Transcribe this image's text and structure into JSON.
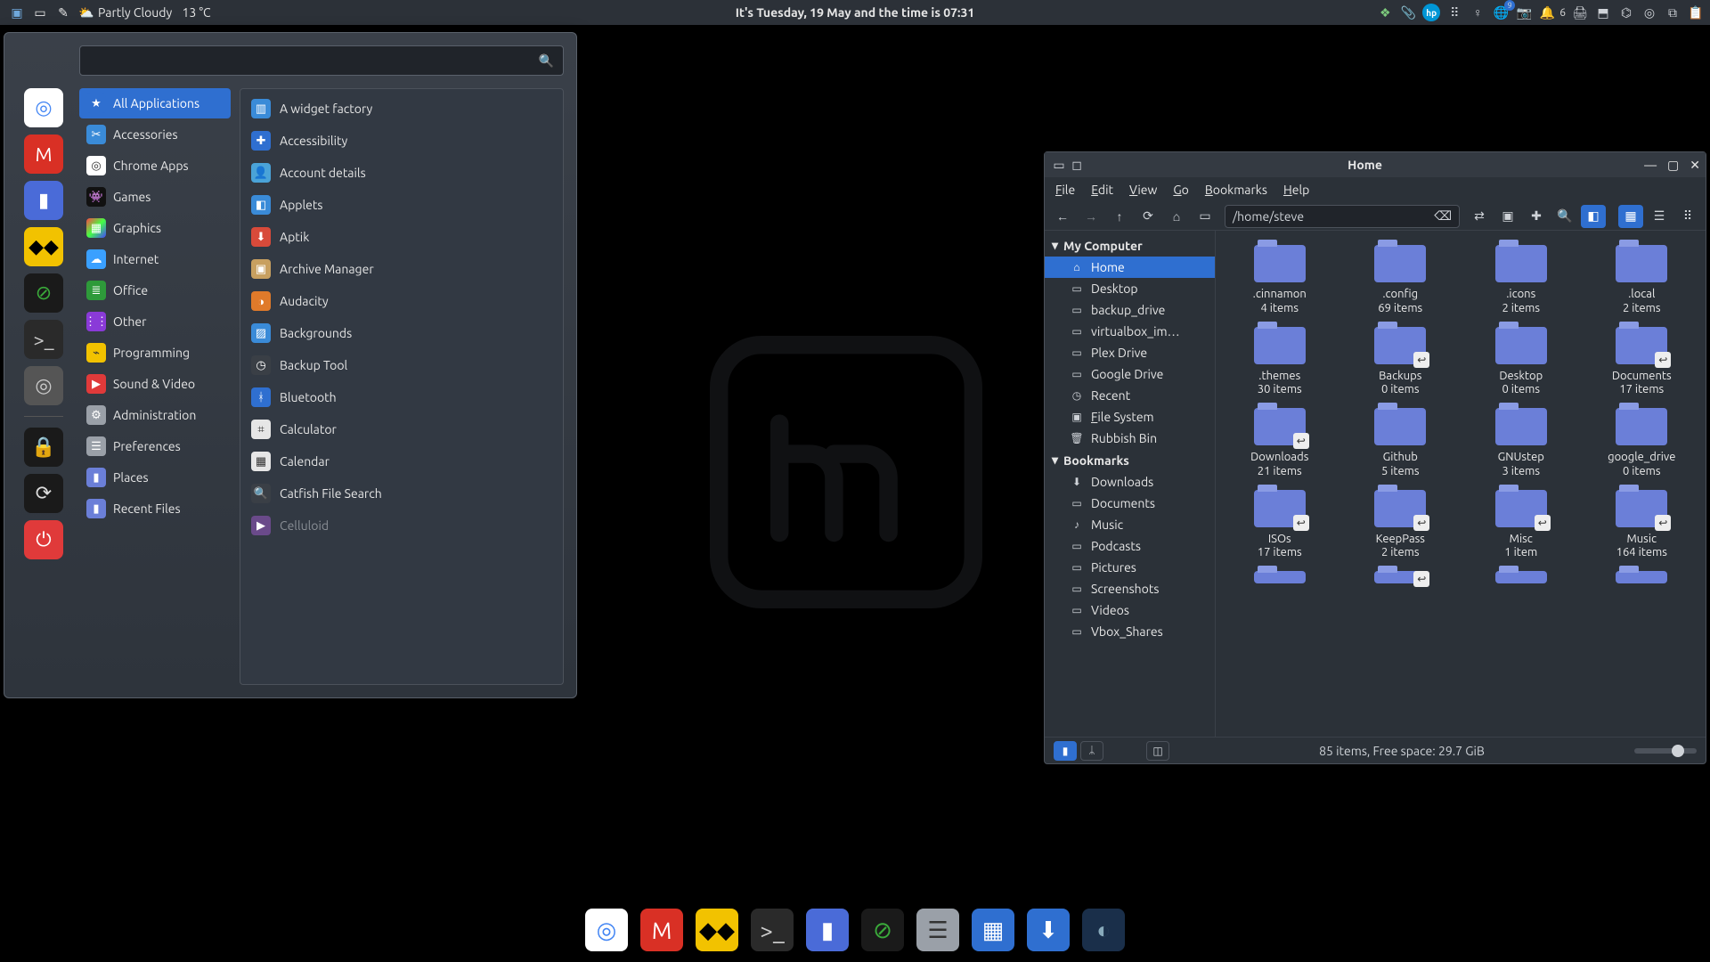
{
  "panel": {
    "weather": {
      "text": "Partly Cloudy",
      "temp": "13 °C"
    },
    "clock": "It's Tuesday, 19 May and the time is 07:31",
    "notif_count": "6",
    "badge_small": "9"
  },
  "menu": {
    "search_placeholder": "",
    "categories": [
      {
        "label": "All Applications",
        "color": "#2f6fd0",
        "active": true,
        "ico": "★"
      },
      {
        "label": "Accessories",
        "color": "#3a8bd8",
        "ico": "✂"
      },
      {
        "label": "Chrome Apps",
        "color": "#ffffff",
        "ico": "◎"
      },
      {
        "label": "Games",
        "color": "#111",
        "ico": "👾"
      },
      {
        "label": "Graphics",
        "color": "linear",
        "ico": "▦"
      },
      {
        "label": "Internet",
        "color": "#3aa0ff",
        "ico": "☁"
      },
      {
        "label": "Office",
        "color": "#2e9a3a",
        "ico": "≣"
      },
      {
        "label": "Other",
        "color": "#8a3ad8",
        "ico": "⋮⋮"
      },
      {
        "label": "Programming",
        "color": "#f2c200",
        "ico": "⌁"
      },
      {
        "label": "Sound & Video",
        "color": "#e03a3a",
        "ico": "▶"
      },
      {
        "label": "Administration",
        "color": "#9aa0a8",
        "ico": "⚙"
      },
      {
        "label": "Preferences",
        "color": "#9aa0a8",
        "ico": "☰"
      },
      {
        "label": "Places",
        "color": "#6b7fd8",
        "ico": "▮"
      },
      {
        "label": "Recent Files",
        "color": "#6b7fd8",
        "ico": "▮"
      }
    ],
    "apps": [
      {
        "label": "A widget factory",
        "ico": "▥",
        "bg": "#3a8bd8"
      },
      {
        "label": "Accessibility",
        "ico": "✚",
        "bg": "#2f6fd0"
      },
      {
        "label": "Account details",
        "ico": "👤",
        "bg": "#4aa3d8"
      },
      {
        "label": "Applets",
        "ico": "◧",
        "bg": "#3a8bd8"
      },
      {
        "label": "Aptik",
        "ico": "⬇",
        "bg": "#d84a3a"
      },
      {
        "label": "Archive Manager",
        "ico": "▣",
        "bg": "#c8a060"
      },
      {
        "label": "Audacity",
        "ico": "◑",
        "bg": "#e07a2a"
      },
      {
        "label": "Backgrounds",
        "ico": "▨",
        "bg": "#3a8bd8"
      },
      {
        "label": "Backup Tool",
        "ico": "◷",
        "bg": "#3a3f46"
      },
      {
        "label": "Bluetooth",
        "ico": "ᚼ",
        "bg": "#2f6fd0"
      },
      {
        "label": "Calculator",
        "ico": "⌗",
        "bg": "#e6e6e6"
      },
      {
        "label": "Calendar",
        "ico": "▦",
        "bg": "#e6e6e6"
      },
      {
        "label": "Catfish File Search",
        "ico": "🔍",
        "bg": "#3a3f46"
      },
      {
        "label": "Celluloid",
        "ico": "▶",
        "bg": "#6a4a8a",
        "dim": true
      }
    ],
    "favorites": [
      {
        "name": "chrome",
        "bg": "#fff",
        "glyph": "◎",
        "fg": "#4285f4"
      },
      {
        "name": "gmail",
        "bg": "#d93025",
        "glyph": "M",
        "fg": "#fff"
      },
      {
        "name": "files",
        "bg": "#4a6bd8",
        "glyph": "▮",
        "fg": "#fff"
      },
      {
        "name": "plex",
        "bg": "#f2c200",
        "glyph": "◆◆",
        "fg": "#000"
      },
      {
        "name": "keepass",
        "bg": "#1a1a1a",
        "glyph": "⊘",
        "fg": "#3aaa3a"
      },
      {
        "name": "terminal",
        "bg": "#2a2a2a",
        "glyph": ">_",
        "fg": "#ccc"
      },
      {
        "name": "steam",
        "bg": "#555",
        "glyph": "◎",
        "fg": "#ccc"
      }
    ],
    "session": [
      {
        "name": "lock",
        "bg": "#1a1a1a",
        "glyph": "🔒",
        "fg": "#fff"
      },
      {
        "name": "logout",
        "bg": "#1a1a1a",
        "glyph": "⟳",
        "fg": "#ddd"
      },
      {
        "name": "shutdown",
        "bg": "#e03a3a",
        "glyph": "⏻",
        "fg": "#fff"
      }
    ]
  },
  "dock": [
    {
      "name": "chrome",
      "bg": "#fff",
      "glyph": "◎",
      "fg": "#4285f4"
    },
    {
      "name": "gmail",
      "bg": "#d93025",
      "glyph": "M",
      "fg": "#fff"
    },
    {
      "name": "plex",
      "bg": "#f2c200",
      "glyph": "◆◆",
      "fg": "#000"
    },
    {
      "name": "terminal",
      "bg": "#2a2a2a",
      "glyph": ">_",
      "fg": "#ccc"
    },
    {
      "name": "files",
      "bg": "#4a6bd8",
      "glyph": "▮",
      "fg": "#fff"
    },
    {
      "name": "keepass",
      "bg": "#1a1a1a",
      "glyph": "⊘",
      "fg": "#3aaa3a"
    },
    {
      "name": "settings",
      "bg": "#9aa0a8",
      "glyph": "☰",
      "fg": "#333"
    },
    {
      "name": "virtualbox",
      "bg": "#2f6fd0",
      "glyph": "▦",
      "fg": "#fff"
    },
    {
      "name": "updater",
      "bg": "#2f6fd0",
      "glyph": "⬇",
      "fg": "#fff"
    },
    {
      "name": "dark-app",
      "bg": "#1a2f4a",
      "glyph": "◐",
      "fg": "#8ab"
    }
  ],
  "fm": {
    "title": "Home",
    "menus": [
      "File",
      "Edit",
      "View",
      "Go",
      "Bookmarks",
      "Help"
    ],
    "path": "/home/steve",
    "side": {
      "mycomputer": "My Computer",
      "items1": [
        {
          "label": "Home",
          "ico": "⌂",
          "sel": true
        },
        {
          "label": "Desktop",
          "ico": "▭"
        },
        {
          "label": "backup_drive",
          "ico": "▭"
        },
        {
          "label": "virtualbox_im…",
          "ico": "▭"
        },
        {
          "label": "Plex Drive",
          "ico": "▭"
        },
        {
          "label": "Google Drive",
          "ico": "▭"
        },
        {
          "label": "Recent",
          "ico": "◷"
        },
        {
          "label": "File System",
          "ico": "▣",
          "u": "F"
        },
        {
          "label": "Rubbish Bin",
          "ico": "🗑"
        }
      ],
      "bookmarks": "Bookmarks",
      "items2": [
        {
          "label": "Downloads",
          "ico": "⬇"
        },
        {
          "label": "Documents",
          "ico": "▭"
        },
        {
          "label": "Music",
          "ico": "♪"
        },
        {
          "label": "Podcasts",
          "ico": "▭"
        },
        {
          "label": "Pictures",
          "ico": "▭"
        },
        {
          "label": "Screenshots",
          "ico": "▭"
        },
        {
          "label": "Videos",
          "ico": "▭"
        },
        {
          "label": "Vbox_Shares",
          "ico": "▭"
        }
      ]
    },
    "grid": [
      {
        "name": ".cinnamon",
        "count": "4 items"
      },
      {
        "name": ".config",
        "count": "69 items"
      },
      {
        "name": ".icons",
        "count": "2 items"
      },
      {
        "name": ".local",
        "count": "2 items"
      },
      {
        "name": ".themes",
        "count": "30 items"
      },
      {
        "name": "Backups",
        "count": "0 items",
        "link": true
      },
      {
        "name": "Desktop",
        "count": "0 items"
      },
      {
        "name": "Documents",
        "count": "17 items",
        "link": true
      },
      {
        "name": "Downloads",
        "count": "21 items",
        "link": true
      },
      {
        "name": "Github",
        "count": "5 items"
      },
      {
        "name": "GNUstep",
        "count": "3 items"
      },
      {
        "name": "google_drive",
        "count": "0 items"
      },
      {
        "name": "ISOs",
        "count": "17 items",
        "link": true
      },
      {
        "name": "KeepPass",
        "count": "2 items",
        "link": true
      },
      {
        "name": "Misc",
        "count": "1 item",
        "link": true
      },
      {
        "name": "Music",
        "count": "164 items",
        "link": true
      },
      {
        "name": "",
        "count": "",
        "cut": true
      },
      {
        "name": "",
        "count": "",
        "cut": true,
        "link": true
      },
      {
        "name": "",
        "count": "",
        "cut": true
      },
      {
        "name": "",
        "count": "",
        "cut": true
      }
    ],
    "status": "85 items, Free space: 29.7 GiB"
  }
}
